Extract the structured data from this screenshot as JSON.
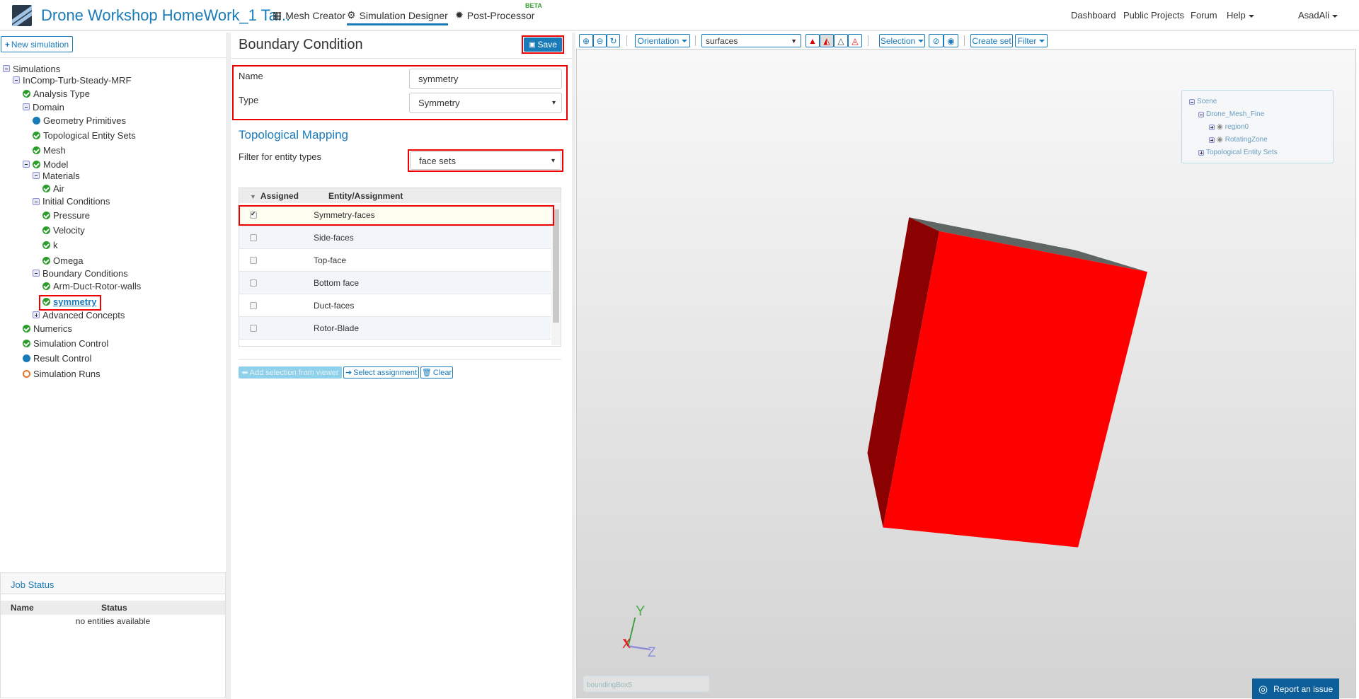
{
  "header": {
    "title": "Drone Workshop HomeWork_1 Ta...",
    "nav": [
      {
        "label": "Mesh Creator",
        "icon": "grid-icon"
      },
      {
        "label": "Simulation Designer",
        "icon": "gears-icon"
      },
      {
        "label": "Post-Processor",
        "icon": "cog-icon"
      }
    ],
    "beta": "BETA",
    "right": [
      "Dashboard",
      "Public Projects",
      "Forum",
      "Help"
    ],
    "user": "AsadAli"
  },
  "left": {
    "new_simulation": "New simulation",
    "tree": [
      "Simulations",
      "InComp-Turb-Steady-MRF",
      "Analysis Type",
      "Domain",
      "Geometry Primitives",
      "Topological Entity Sets",
      "Mesh",
      "Model",
      "Materials",
      "Air",
      "Initial Conditions",
      "Pressure",
      "Velocity",
      "k",
      "Omega",
      "Boundary Conditions",
      "Arm-Duct-Rotor-walls",
      "symmetry",
      "Advanced Concepts",
      "Numerics",
      "Simulation Control",
      "Result Control",
      "Simulation Runs"
    ],
    "job_status": {
      "title": "Job Status",
      "columns": [
        "Name",
        "Status"
      ],
      "empty": "no entities available"
    }
  },
  "form": {
    "title": "Boundary Condition",
    "save": "Save",
    "name_label": "Name",
    "name_value": "symmetry",
    "type_label": "Type",
    "type_value": "Symmetry",
    "section": "Topological Mapping",
    "filter_label": "Filter for entity types",
    "filter_value": "face sets",
    "table": {
      "columns": [
        "Assigned",
        "Entity/Assignment"
      ],
      "rows": [
        {
          "name": "Symmetry-faces",
          "checked": true
        },
        {
          "name": "Side-faces",
          "checked": false
        },
        {
          "name": "Top-face",
          "checked": false
        },
        {
          "name": "Bottom face",
          "checked": false
        },
        {
          "name": "Duct-faces",
          "checked": false
        },
        {
          "name": "Rotor-Blade",
          "checked": false
        }
      ]
    },
    "buttons": {
      "add": "Add selection from viewer",
      "select": "Select assignment",
      "clear": "Clear"
    }
  },
  "viewer": {
    "orientation": "Orientation",
    "render_mode": "surfaces",
    "selection": "Selection",
    "create_set": "Create set",
    "filter": "Filter",
    "scene": {
      "root": "Scene",
      "mesh": "Drone_Mesh_Fine",
      "regions": [
        "region0",
        "RotatingZone"
      ],
      "sets": "Topological Entity Sets"
    },
    "axes": {
      "x": "X",
      "y": "Y",
      "z": "Z"
    },
    "bbox_label": "boundingBox5",
    "report": "Report an issue"
  },
  "colors": {
    "accent": "#1a7bb9",
    "highlight": "#e00000",
    "model": "#ff0000"
  }
}
